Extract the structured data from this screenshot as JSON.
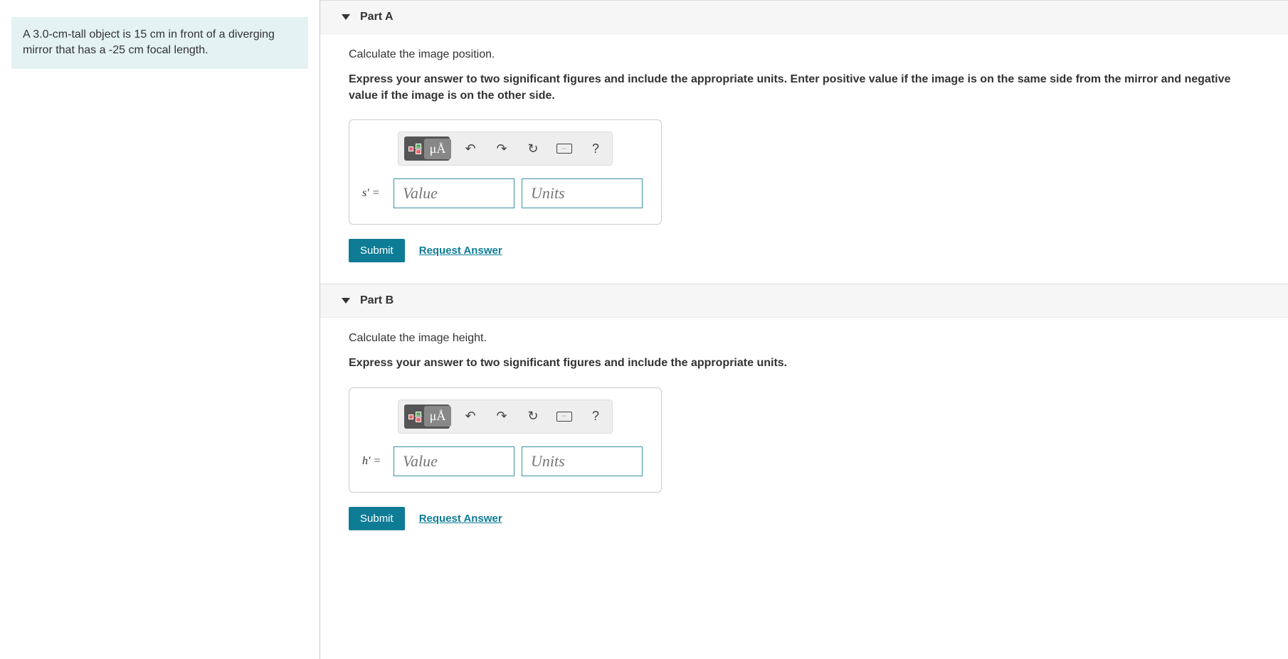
{
  "problem": {
    "text": "A 3.0-cm-tall object is 15 cm in front of a diverging mirror that has a -25 cm focal length."
  },
  "parts": {
    "a": {
      "title": "Part A",
      "question": "Calculate the image position.",
      "instructions": "Express your answer to two significant figures and include the appropriate units. Enter positive value if the image is on the same side from the mirror and negative value if the image is on the other side.",
      "variable": "s′ =",
      "value_placeholder": "Value",
      "units_placeholder": "Units",
      "submit_label": "Submit",
      "request_label": "Request Answer",
      "toolbar": {
        "mua": "μÅ",
        "help": "?"
      }
    },
    "b": {
      "title": "Part B",
      "question": "Calculate the image height.",
      "instructions": "Express your answer to two significant figures and include the appropriate units.",
      "variable": "h′ =",
      "value_placeholder": "Value",
      "units_placeholder": "Units",
      "submit_label": "Submit",
      "request_label": "Request Answer",
      "toolbar": {
        "mua": "μÅ",
        "help": "?"
      }
    }
  }
}
